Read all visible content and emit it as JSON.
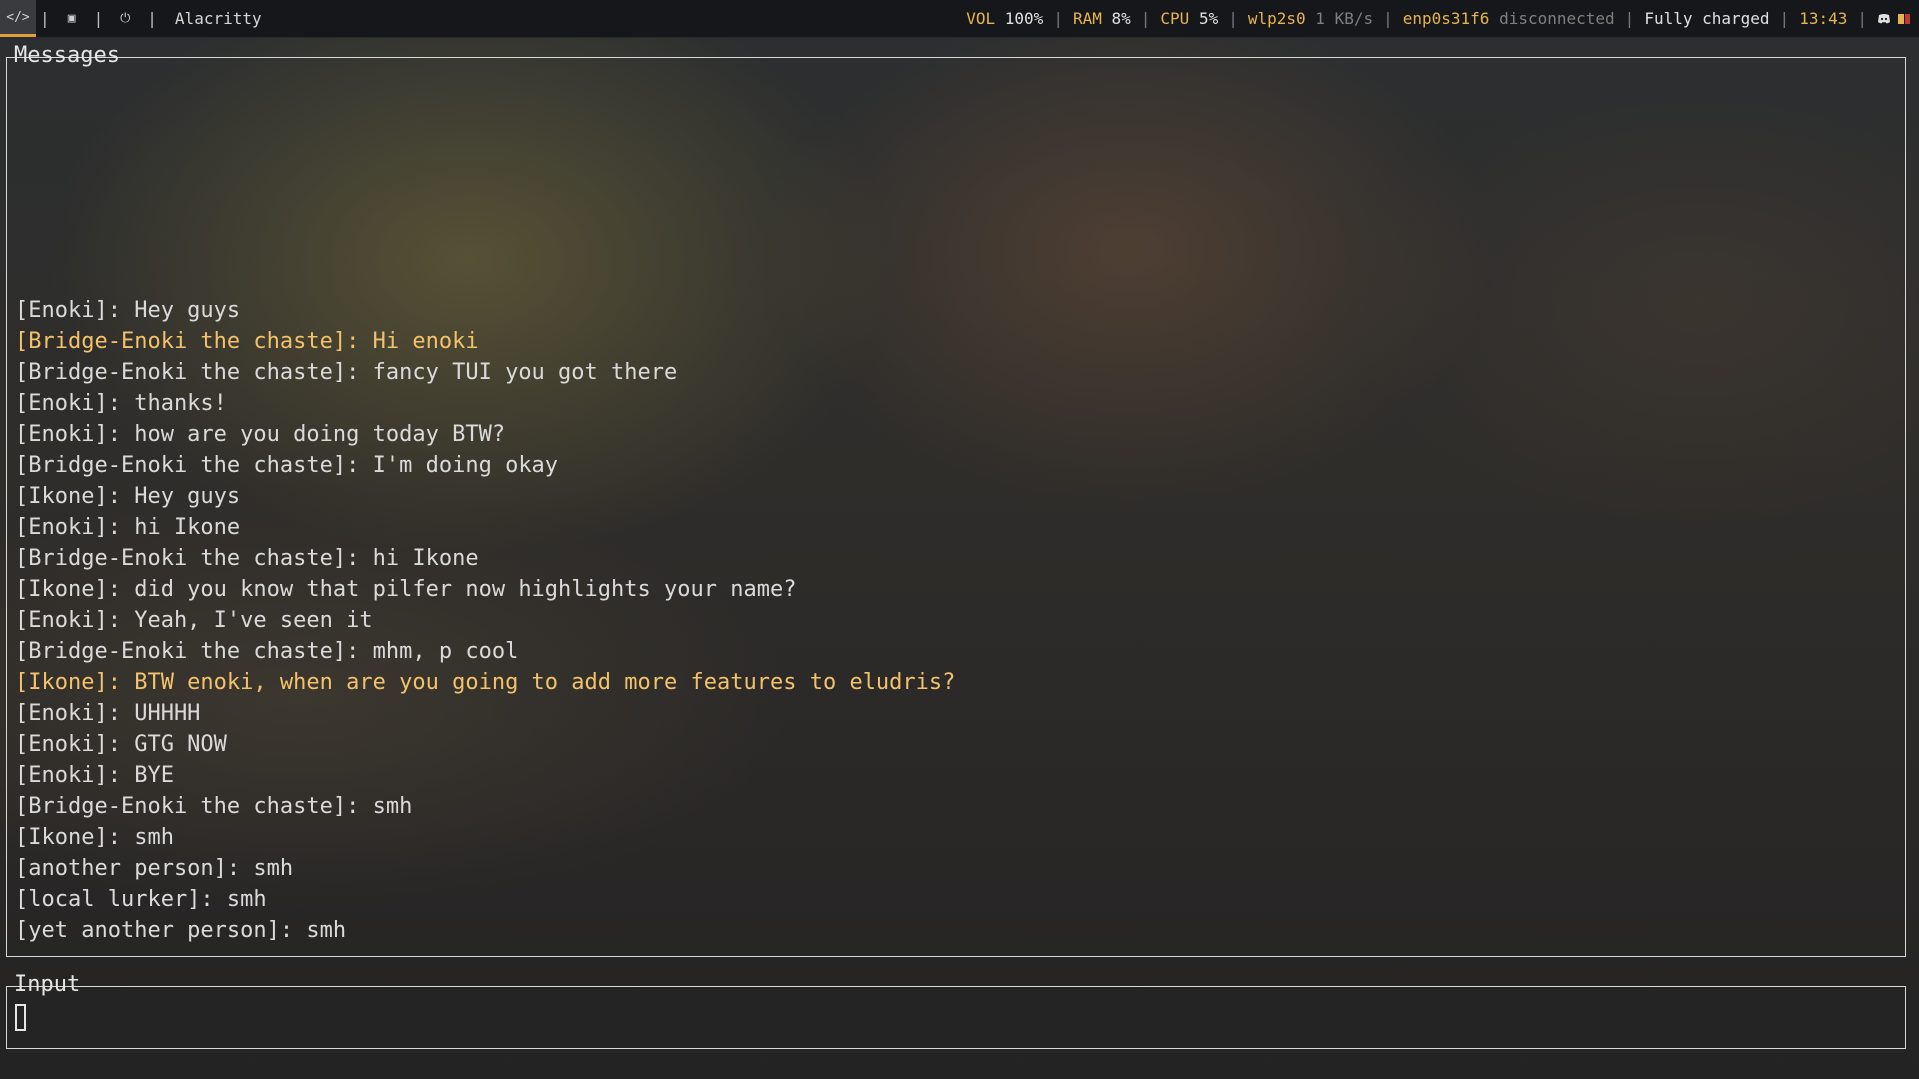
{
  "topbar": {
    "workspaces": [
      {
        "icon": "code-icon",
        "glyph": "</>",
        "active": true
      },
      {
        "icon": "chat-icon",
        "glyph": "▣",
        "active": false
      },
      {
        "icon": "power-icon",
        "glyph": "⏻",
        "active": false
      }
    ],
    "window_title": "Alacritty",
    "vol_label": "VOL",
    "vol_value": "100%",
    "ram_label": "RAM",
    "ram_value": "8%",
    "cpu_label": "CPU",
    "cpu_value": "5%",
    "wifi_label": "wlp2s0",
    "wifi_value": "1 KB/s",
    "eth_label": "enp0s31f6",
    "eth_value": "disconnected",
    "battery": "Fully charged",
    "clock": "13:43",
    "tray": [
      "discord-icon",
      "battery-tray-icon"
    ],
    "accent": "#e6b450"
  },
  "messages_panel": {
    "title": "Messages",
    "messages": [
      {
        "text": "[Enoki]: Hey guys",
        "highlight": false
      },
      {
        "text": "[Bridge-Enoki the chaste]: Hi enoki",
        "highlight": true
      },
      {
        "text": "[Bridge-Enoki the chaste]: fancy TUI you got there",
        "highlight": false
      },
      {
        "text": "[Enoki]: thanks!",
        "highlight": false
      },
      {
        "text": "[Enoki]: how are you doing today BTW?",
        "highlight": false
      },
      {
        "text": "[Bridge-Enoki the chaste]: I'm doing okay",
        "highlight": false
      },
      {
        "text": "[Ikone]: Hey guys",
        "highlight": false
      },
      {
        "text": "[Enoki]: hi Ikone",
        "highlight": false
      },
      {
        "text": "[Bridge-Enoki the chaste]: hi Ikone",
        "highlight": false
      },
      {
        "text": "[Ikone]: did you know that pilfer now highlights your name?",
        "highlight": false
      },
      {
        "text": "[Enoki]: Yeah, I've seen it",
        "highlight": false
      },
      {
        "text": "[Bridge-Enoki the chaste]: mhm, p cool",
        "highlight": false
      },
      {
        "text": "[Ikone]: BTW enoki, when are you going to add more features to eludris?",
        "highlight": true
      },
      {
        "text": "[Enoki]: UHHHH",
        "highlight": false
      },
      {
        "text": "[Enoki]: GTG NOW",
        "highlight": false
      },
      {
        "text": "[Enoki]: BYE",
        "highlight": false
      },
      {
        "text": "[Bridge-Enoki the chaste]: smh",
        "highlight": false
      },
      {
        "text": "[Ikone]: smh",
        "highlight": false
      },
      {
        "text": "[another person]: smh",
        "highlight": false
      },
      {
        "text": "[local lurker]: smh",
        "highlight": false
      },
      {
        "text": "[yet another person]: smh",
        "highlight": false
      }
    ],
    "highlight_color": "#f3c26a"
  },
  "input_panel": {
    "title": "Input",
    "value": ""
  }
}
